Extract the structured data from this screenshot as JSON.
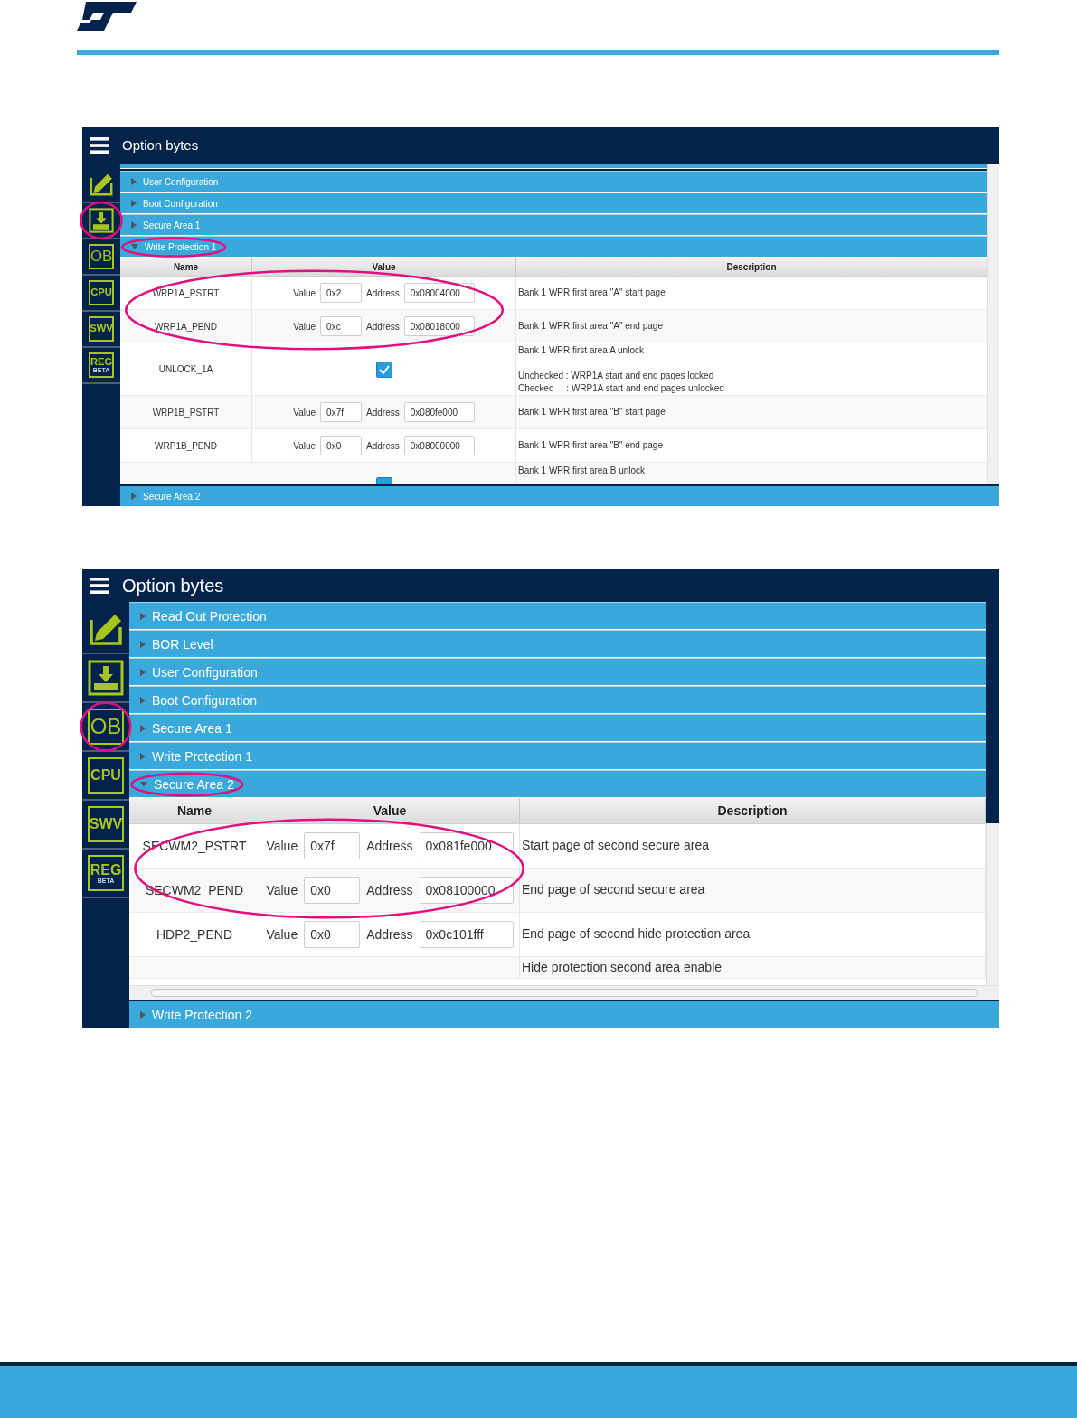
{
  "panels": [
    {
      "title": "Option bytes",
      "horizontal_scrollbar": false,
      "sidebar": [
        {
          "kind": "pencil",
          "circled": false
        },
        {
          "kind": "download",
          "circled": true
        },
        {
          "kind": "text",
          "label": "OB",
          "circled": false
        },
        {
          "kind": "text",
          "label": "CPU",
          "circled": false
        },
        {
          "kind": "text",
          "label": "SWV",
          "circled": false
        },
        {
          "kind": "text",
          "label": "REG",
          "sublabel": "BETA",
          "circled": false
        }
      ],
      "sections": [
        {
          "label": "User Configuration",
          "expanded": false,
          "circled": false
        },
        {
          "label": "Boot Configuration",
          "expanded": false,
          "circled": false
        },
        {
          "label": "Secure Area 1",
          "expanded": false,
          "circled": false
        },
        {
          "label": "Write Protection 1",
          "expanded": true,
          "circled": true
        }
      ],
      "columns": [
        "Name",
        "Value",
        "Description"
      ],
      "rows": [
        {
          "kind": "field",
          "name": "WRP1A_PSTRT",
          "value_label": "Value",
          "value": "0x2",
          "address_label": "Address",
          "address": "0x08004000",
          "description": [
            "Bank 1 WPR first area \"A\" start page"
          ],
          "circled": true,
          "partial": false
        },
        {
          "kind": "field",
          "name": "WRP1A_PEND",
          "value_label": "Value",
          "value": "0xc",
          "address_label": "Address",
          "address": "0x08018000",
          "description": [
            "Bank 1 WPR first area \"A\" end page"
          ],
          "circled": true,
          "partial": false
        },
        {
          "kind": "checkbox",
          "name": "UNLOCK_1A",
          "checked": true,
          "description": [
            "Bank 1 WPR first area A unlock"
          ],
          "notes": [
            "Unchecked : WRP1A start and end pages locked",
            "Checked     : WRP1A start and end pages unlocked"
          ],
          "circled": false,
          "partial": false
        },
        {
          "kind": "field",
          "name": "WRP1B_PSTRT",
          "value_label": "Value",
          "value": "0x7f",
          "address_label": "Address",
          "address": "0x080fe000",
          "description": [
            "Bank 1 WPR first area \"B\" start page"
          ],
          "circled": false,
          "partial": false
        },
        {
          "kind": "field",
          "name": "WRP1B_PEND",
          "value_label": "Value",
          "value": "0x0",
          "address_label": "Address",
          "address": "0x08000000",
          "description": [
            "Bank 1 WPR first area \"B\" end page"
          ],
          "circled": false,
          "partial": false
        },
        {
          "kind": "checkbox",
          "checked": true,
          "description": [
            "Bank 1 WPR first area B unlock"
          ],
          "circled": false,
          "partial": true
        }
      ],
      "sections_after": [
        {
          "label": "Secure Area 2",
          "expanded": false
        }
      ]
    },
    {
      "title": "Option bytes",
      "horizontal_scrollbar": true,
      "sidebar": [
        {
          "kind": "pencil",
          "circled": false
        },
        {
          "kind": "download",
          "circled": false
        },
        {
          "kind": "text",
          "label": "OB",
          "circled": true
        },
        {
          "kind": "text",
          "label": "CPU",
          "circled": false
        },
        {
          "kind": "text",
          "label": "SWV",
          "circled": false
        },
        {
          "kind": "text",
          "label": "REG",
          "sublabel": "BETA",
          "circled": false
        }
      ],
      "sections": [
        {
          "label": "Read Out Protection",
          "expanded": false,
          "circled": false
        },
        {
          "label": "BOR Level",
          "expanded": false,
          "circled": false
        },
        {
          "label": "User Configuration",
          "expanded": false,
          "circled": false
        },
        {
          "label": "Boot Configuration",
          "expanded": false,
          "circled": false
        },
        {
          "label": "Secure Area 1",
          "expanded": false,
          "circled": false
        },
        {
          "label": "Write Protection 1",
          "expanded": false,
          "circled": false
        },
        {
          "label": "Secure Area 2",
          "expanded": true,
          "circled": true
        }
      ],
      "columns": [
        "Name",
        "Value",
        "Description"
      ],
      "rows": [
        {
          "kind": "field",
          "name": "SECWM2_PSTRT",
          "value_label": "Value",
          "value": "0x7f",
          "address_label": "Address",
          "address": "0x081fe000",
          "description": [
            "Start page of second secure area"
          ],
          "circled": true,
          "partial": false
        },
        {
          "kind": "field",
          "name": "SECWM2_PEND",
          "value_label": "Value",
          "value": "0x0",
          "address_label": "Address",
          "address": "0x08100000",
          "description": [
            "End page of second secure area"
          ],
          "circled": true,
          "partial": false
        },
        {
          "kind": "field",
          "name": "HDP2_PEND",
          "value_label": "Value",
          "value": "0x0",
          "address_label": "Address",
          "address": "0x0c101fff",
          "description": [
            "End page of second hide protection area"
          ],
          "circled": false,
          "partial": false
        },
        {
          "kind": "empty",
          "description": [
            "Hide protection second area enable"
          ],
          "circled": false,
          "partial": true
        }
      ],
      "sections_after": [
        {
          "label": "Write Protection 2",
          "expanded": false
        }
      ]
    }
  ]
}
